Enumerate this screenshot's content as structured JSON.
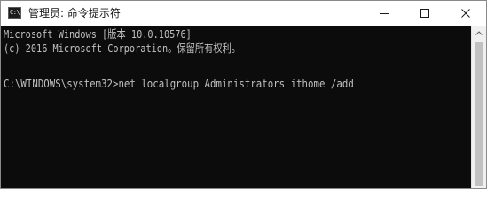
{
  "window": {
    "title": "管理员: 命令提示符",
    "icon": "cmd-icon",
    "icon_text": "C:\\",
    "controls": [
      "minimize-icon",
      "maximize-icon",
      "close-icon"
    ]
  },
  "console": {
    "lines": [
      "Microsoft Windows [版本 10.0.10576]",
      "(c) 2016 Microsoft Corporation。保留所有权利。",
      "",
      "C:\\WINDOWS\\system32>net localgroup Administrators ithome /add"
    ],
    "text_color": "#c0c0c0",
    "background_color": "#0c0c0c"
  },
  "scrollbar": {
    "up_icon": "scroll-up-arrow-icon"
  }
}
